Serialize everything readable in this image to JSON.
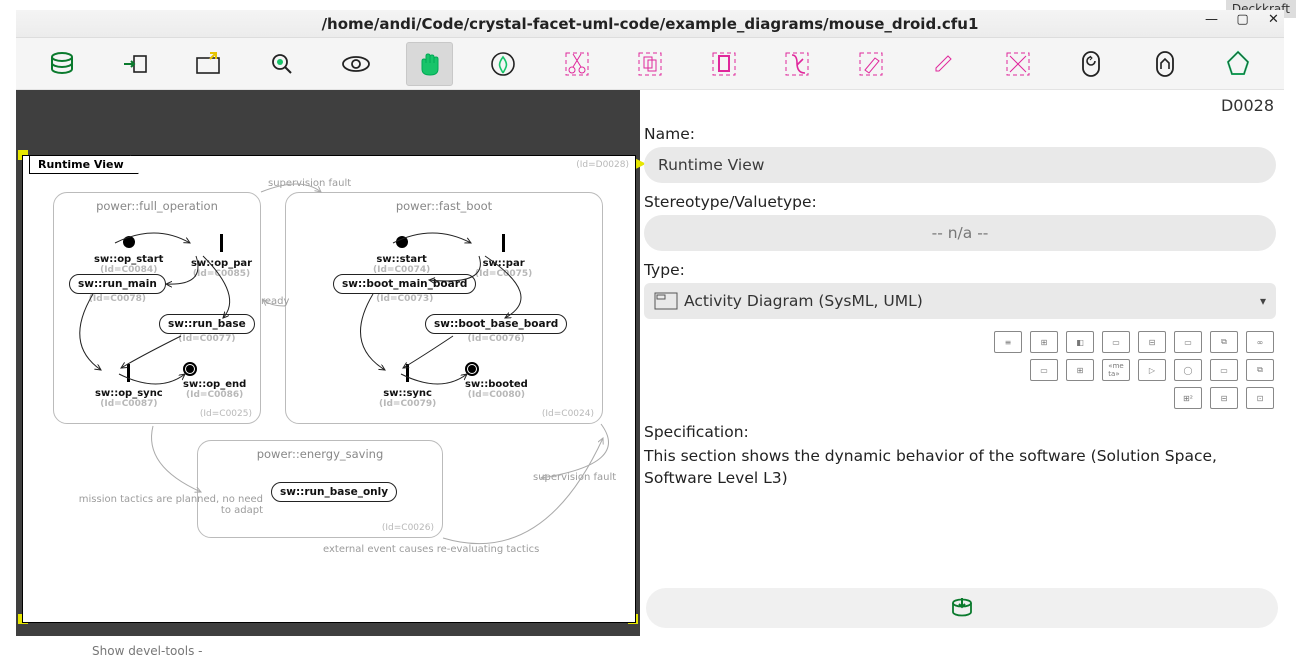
{
  "chrome": {
    "deckkraft": "Deckkraft",
    "behind_line": "Show devel-tools -"
  },
  "titlebar": {
    "path": "/home/andi/Code/crystal-facet-uml-code/example_diagrams/mouse_droid.cfu1"
  },
  "toolbar": {
    "btns": [
      "db",
      "export",
      "new-window",
      "search",
      "view",
      "hand",
      "create",
      "cut",
      "copy",
      "paste",
      "delete",
      "highlight",
      "edit",
      "reset",
      "undo",
      "redo",
      "about"
    ]
  },
  "diagram": {
    "title": "Runtime View",
    "id": "(Id=D0028)",
    "regions": {
      "full_op": {
        "label": "power::full_operation",
        "id": "(Id=C0025)",
        "op_start": "sw::op_start",
        "id_op_start": "(Id=C0084)",
        "op_par": "sw::op_par",
        "id_op_par": "(Id=C0085)",
        "run_main": "sw::run_main",
        "id_run_main": "(Id=C0078)",
        "run_base": "sw::run_base",
        "id_run_base": "(Id=C0077)",
        "op_sync": "sw::op_sync",
        "id_op_sync": "(Id=C0087)",
        "op_end": "sw::op_end",
        "id_op_end": "(Id=C0086)"
      },
      "fast_boot": {
        "label": "power::fast_boot",
        "id": "(Id=C0024)",
        "start": "sw::start",
        "id_start": "(Id=C0074)",
        "par": "sw::par",
        "id_par": "(Id=C0075)",
        "boot_main": "sw::boot_main_board",
        "id_boot_main": "(Id=C0073)",
        "boot_base": "sw::boot_base_board",
        "id_boot_base": "(Id=C0076)",
        "sync": "sw::sync",
        "id_sync": "(Id=C0079)",
        "booted": "sw::booted",
        "id_booted": "(Id=C0080)"
      },
      "energy": {
        "label": "power::energy_saving",
        "id": "(Id=C0026)",
        "run_base_only": "sw::run_base_only"
      }
    },
    "edges": {
      "supervision_fault": "supervision fault",
      "ready": "ready",
      "mission": "mission tactics are planned, no need to adapt",
      "external": "external event causes re-evaluating tactics"
    }
  },
  "panel": {
    "id": "D0028",
    "name_label": "Name:",
    "name_value": "Runtime View",
    "stereo_label": "Stereotype/Valuetype:",
    "stereo_value": "-- n/a --",
    "type_label": "Type:",
    "type_value": "Activity Diagram (SysML, UML)",
    "spec_label": "Specification:",
    "spec_value": "This section shows the dynamic behavior of the software (Solution Space, Software Level L3)"
  }
}
